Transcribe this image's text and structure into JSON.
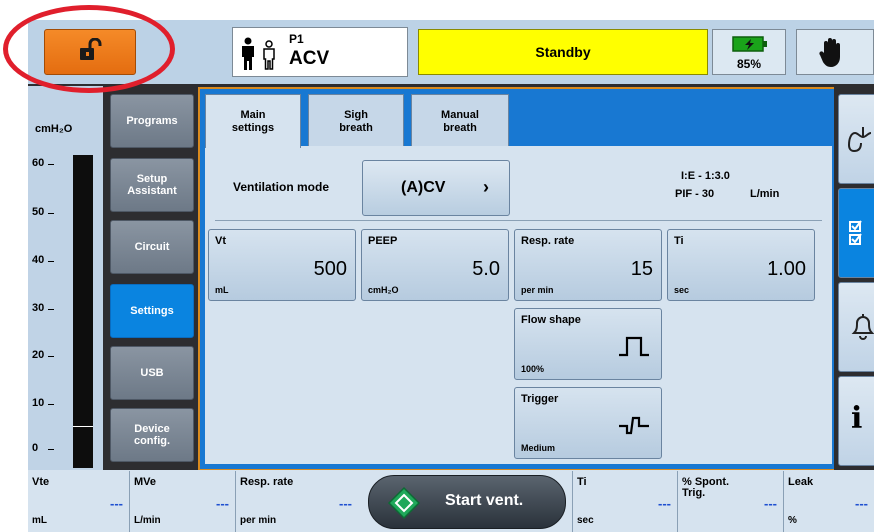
{
  "topbar": {
    "lock_icon": "unlocked-padlock-icon",
    "patient_icons": [
      "adult-patient-icon",
      "pediatric-patient-icon"
    ],
    "patient_id": "P1",
    "patient_mode": "ACV",
    "status": "Standby",
    "battery_percent": "85%",
    "battery_icon": "battery-charging-icon",
    "hand_icon": "manual-hand-icon",
    "colors": {
      "lock_bg": "#f07f1e",
      "status_bg": "#ffff00",
      "active_blue": "#0a84e0"
    }
  },
  "pressure": {
    "unit": "cmH₂O",
    "ticks": [
      "60",
      "50",
      "40",
      "30",
      "20",
      "10",
      "0"
    ]
  },
  "left_tabs": [
    {
      "label": "Programs",
      "active": false
    },
    {
      "label": "Setup\nAssistant",
      "active": false
    },
    {
      "label": "Circuit",
      "active": false
    },
    {
      "label": "Settings",
      "active": true
    },
    {
      "label": "USB",
      "active": false
    },
    {
      "label": "Device\nconfig.",
      "active": false
    }
  ],
  "main_tabs": [
    {
      "label": "Main\nsettings",
      "active": true
    },
    {
      "label": "Sigh\nbreath",
      "active": false
    },
    {
      "label": "Manual\nbreath",
      "active": false
    }
  ],
  "ventilation": {
    "label": "Ventilation mode",
    "value": "(A)CV",
    "ie_ratio": "I:E - 1:3.0",
    "pif": "PIF - 30",
    "pif_unit": "L/min"
  },
  "params": {
    "vt": {
      "name": "Vt",
      "value": "500",
      "unit": "mL"
    },
    "peep": {
      "name": "PEEP",
      "value": "5.0",
      "unit": "cmH₂O"
    },
    "rate": {
      "name": "Resp. rate",
      "value": "15",
      "unit": "per min"
    },
    "ti": {
      "name": "Ti",
      "value": "1.00",
      "unit": "sec"
    },
    "flow": {
      "name": "Flow shape",
      "unit": "100%",
      "icon": "square-flow-wave-icon"
    },
    "trigger": {
      "name": "Trigger",
      "unit": "Medium",
      "icon": "trigger-wave-icon"
    }
  },
  "right_icons": [
    "lungs-icon",
    "checklist-icon",
    "alarm-bell-icon",
    "info-icon"
  ],
  "monitor": [
    {
      "name": "Vte",
      "value": "---",
      "unit": "mL"
    },
    {
      "name": "MVe",
      "value": "---",
      "unit": "L/min"
    },
    {
      "name": "Resp. rate",
      "value": "---",
      "unit": "per min"
    },
    {
      "name": "Ti",
      "value": "---",
      "unit": "sec"
    },
    {
      "name": "% Spont.\nTrig.",
      "value": "---",
      "unit": ""
    },
    {
      "name": "Leak",
      "value": "---",
      "unit": "%"
    }
  ],
  "start": {
    "label": "Start vent.",
    "icon": "start-diamond-icon"
  }
}
